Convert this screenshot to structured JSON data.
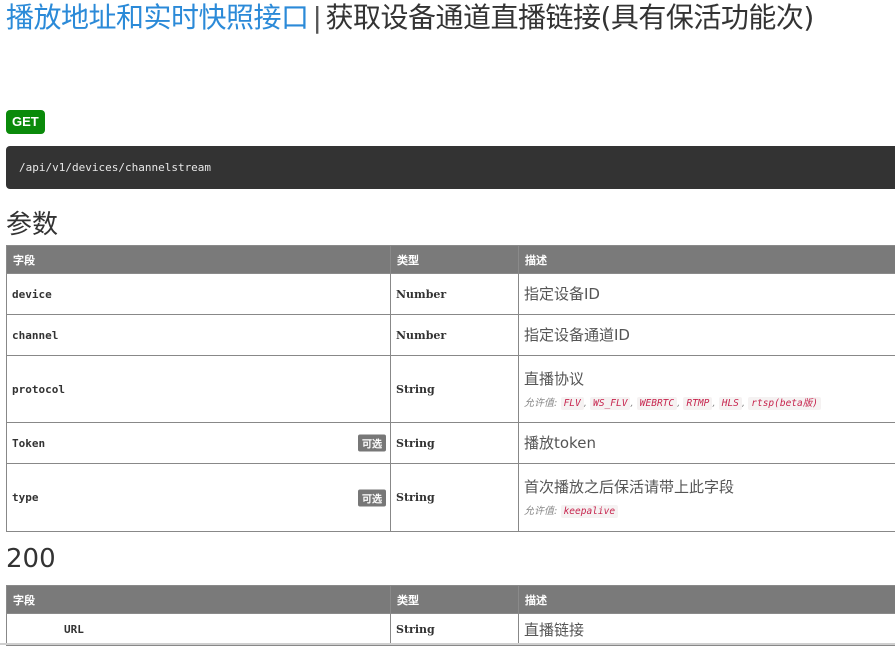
{
  "header": {
    "group": "播放地址和实时快照接口",
    "separator": "|",
    "name": "获取设备通道直播链接(具有保活功能次)"
  },
  "method": "GET",
  "url": "/api/v1/devices/channelstream",
  "params_section": {
    "title": "参数",
    "columns": [
      "字段",
      "类型",
      "描述"
    ],
    "rows": [
      {
        "field": "device",
        "type": "Number",
        "desc": "指定设备ID"
      },
      {
        "field": "channel",
        "type": "Number",
        "desc": "指定设备通道ID"
      },
      {
        "field": "protocol",
        "type": "String",
        "desc": "直播协议",
        "allowed_label": "允许值:",
        "allowed": [
          "FLV",
          "WS_FLV",
          "WEBRTC",
          "RTMP",
          "HLS",
          "rtsp(beta版)"
        ]
      },
      {
        "field": "Token",
        "type": "String",
        "desc": "播放token",
        "optional": "可选"
      },
      {
        "field": "type",
        "type": "String",
        "desc": "首次播放之后保活请带上此字段",
        "optional": "可选",
        "allowed_label": "允许值:",
        "allowed": [
          "keepalive"
        ]
      }
    ]
  },
  "response_section": {
    "title": "200",
    "columns": [
      "字段",
      "类型",
      "描述"
    ],
    "rows": [
      {
        "field": "URL",
        "type": "String",
        "desc": "直播链接"
      }
    ]
  },
  "colors": {
    "link_blue": "#2b8ad8",
    "get_green": "#0a8a0a",
    "header_gray": "#7a7a7a",
    "code_bg": "#333333",
    "code_red": "#c7254e"
  }
}
